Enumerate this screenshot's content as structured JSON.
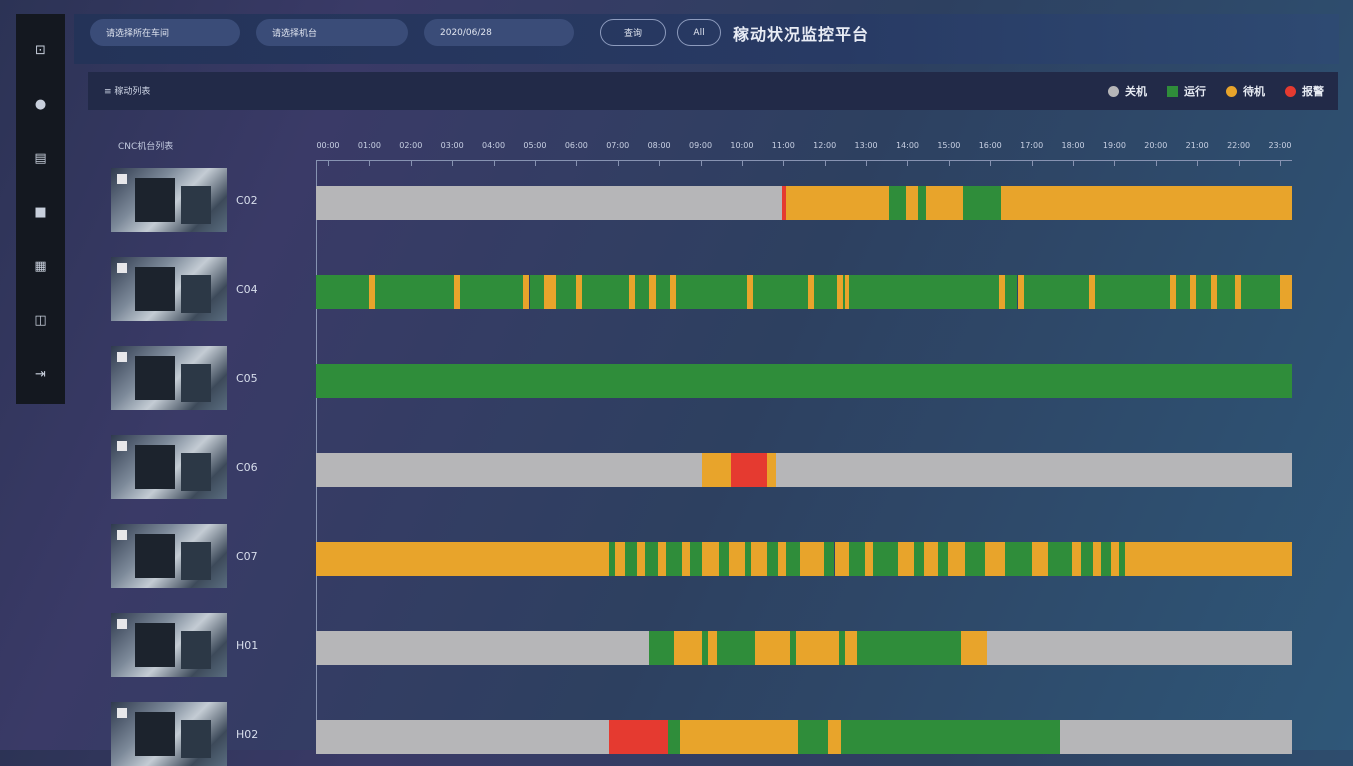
{
  "sidebar": {
    "items": [
      {
        "icon": "monitor-icon",
        "glyph": "⊡"
      },
      {
        "icon": "dashboard-icon",
        "glyph": "●"
      },
      {
        "icon": "chart-icon",
        "glyph": "▤"
      },
      {
        "icon": "document-icon",
        "glyph": "■"
      },
      {
        "icon": "grid-icon",
        "glyph": "▦"
      },
      {
        "icon": "calendar-icon",
        "glyph": "◫"
      },
      {
        "icon": "expand-icon",
        "glyph": "⇥"
      }
    ]
  },
  "topbar": {
    "workshop_select": "请选择所在车间",
    "machine_select": "请选择机台",
    "date_input": "2020/06/28",
    "query_button": "查询",
    "all_button": "All",
    "page_title": "稼动状况监控平台"
  },
  "panel": {
    "title": "≡ 稼动列表",
    "list_label": "CNC机台列表",
    "legend": [
      {
        "label": "关机",
        "color": "#b6b6b8",
        "shape": "dot"
      },
      {
        "label": "运行",
        "color": "#2f8d3a",
        "shape": "square"
      },
      {
        "label": "待机",
        "color": "#e8a42b",
        "shape": "dot"
      },
      {
        "label": "报警",
        "color": "#e53a30",
        "shape": "dot"
      }
    ]
  },
  "timeline": {
    "hours": [
      "00:00",
      "01:00",
      "02:00",
      "03:00",
      "04:00",
      "05:00",
      "06:00",
      "07:00",
      "08:00",
      "09:00",
      "10:00",
      "11:00",
      "12:00",
      "13:00",
      "14:00",
      "15:00",
      "16:00",
      "17:00",
      "18:00",
      "19:00",
      "20:00",
      "21:00",
      "22:00",
      "23:00"
    ]
  },
  "colors": {
    "off": "#b6b6b8",
    "run": "#2f8d3a",
    "idle": "#e8a42b",
    "alarm": "#e53a30"
  },
  "machines": [
    {
      "id": "C02",
      "segments": [
        [
          "off",
          0,
          11.45
        ],
        [
          "alarm",
          11.45,
          11.55
        ],
        [
          "idle",
          11.55,
          14.1
        ],
        [
          "run",
          14.1,
          14.5
        ],
        [
          "idle",
          14.5,
          14.8
        ],
        [
          "run",
          14.8,
          15.0
        ],
        [
          "idle",
          15.0,
          15.9
        ],
        [
          "run",
          15.9,
          16.85
        ],
        [
          "idle",
          16.85,
          24
        ]
      ]
    },
    {
      "id": "C04",
      "segments": [
        [
          "run",
          0,
          1.3
        ],
        [
          "idle",
          1.3,
          1.45
        ],
        [
          "run",
          1.45,
          3.4
        ],
        [
          "idle",
          3.4,
          3.55
        ],
        [
          "run",
          3.55,
          5.1
        ],
        [
          "idle",
          5.1,
          5.25
        ],
        [
          "run",
          5.25,
          5.6
        ],
        [
          "idle",
          5.6,
          5.9
        ],
        [
          "run",
          5.9,
          6.4
        ],
        [
          "idle",
          6.4,
          6.55
        ],
        [
          "run",
          6.55,
          7.7
        ],
        [
          "idle",
          7.7,
          7.85
        ],
        [
          "run",
          7.85,
          8.2
        ],
        [
          "idle",
          8.2,
          8.35
        ],
        [
          "run",
          8.35,
          8.7
        ],
        [
          "idle",
          8.7,
          8.85
        ],
        [
          "run",
          8.85,
          10.6
        ],
        [
          "idle",
          10.6,
          10.75
        ],
        [
          "run",
          10.75,
          12.1
        ],
        [
          "idle",
          12.1,
          12.25
        ],
        [
          "run",
          12.25,
          12.8
        ],
        [
          "idle",
          12.8,
          12.95
        ],
        [
          "run",
          12.95,
          13.0
        ],
        [
          "idle",
          13.0,
          13.1
        ],
        [
          "run",
          13.1,
          16.8
        ],
        [
          "idle",
          16.8,
          16.95
        ],
        [
          "run",
          16.95,
          17.25
        ],
        [
          "idle",
          17.25,
          17.4
        ],
        [
          "run",
          17.4,
          19.0
        ],
        [
          "idle",
          19.0,
          19.15
        ],
        [
          "run",
          19.15,
          21.0
        ],
        [
          "idle",
          21.0,
          21.15
        ],
        [
          "run",
          21.15,
          21.5
        ],
        [
          "idle",
          21.5,
          21.65
        ],
        [
          "run",
          21.65,
          22.0
        ],
        [
          "idle",
          22.0,
          22.15
        ],
        [
          "run",
          22.15,
          22.6
        ],
        [
          "idle",
          22.6,
          22.75
        ],
        [
          "run",
          22.75,
          23.7
        ],
        [
          "idle",
          23.7,
          24
        ]
      ]
    },
    {
      "id": "C05",
      "segments": [
        [
          "run",
          0,
          24
        ]
      ]
    },
    {
      "id": "C06",
      "segments": [
        [
          "off",
          0,
          9.5
        ],
        [
          "idle",
          9.5,
          10.2
        ],
        [
          "alarm",
          10.2,
          11.1
        ],
        [
          "idle",
          11.1,
          11.3
        ],
        [
          "off",
          11.3,
          24
        ]
      ]
    },
    {
      "id": "C07",
      "segments": [
        [
          "idle",
          0,
          7.2
        ],
        [
          "run",
          7.2,
          7.35
        ],
        [
          "idle",
          7.35,
          7.6
        ],
        [
          "run",
          7.6,
          7.9
        ],
        [
          "idle",
          7.9,
          8.1
        ],
        [
          "run",
          8.1,
          8.4
        ],
        [
          "idle",
          8.4,
          8.6
        ],
        [
          "run",
          8.6,
          9.0
        ],
        [
          "idle",
          9.0,
          9.2
        ],
        [
          "run",
          9.2,
          9.5
        ],
        [
          "idle",
          9.5,
          9.9
        ],
        [
          "run",
          9.9,
          10.15
        ],
        [
          "idle",
          10.15,
          10.55
        ],
        [
          "run",
          10.55,
          10.7
        ],
        [
          "idle",
          10.7,
          11.1
        ],
        [
          "run",
          11.1,
          11.35
        ],
        [
          "idle",
          11.35,
          11.55
        ],
        [
          "run",
          11.55,
          11.9
        ],
        [
          "idle",
          11.9,
          12.5
        ],
        [
          "run",
          12.5,
          12.75
        ],
        [
          "idle",
          12.75,
          13.1
        ],
        [
          "run",
          13.1,
          13.5
        ],
        [
          "idle",
          13.5,
          13.7
        ],
        [
          "run",
          13.7,
          14.3
        ],
        [
          "idle",
          14.3,
          14.7
        ],
        [
          "run",
          14.7,
          14.95
        ],
        [
          "idle",
          14.95,
          15.3
        ],
        [
          "run",
          15.3,
          15.55
        ],
        [
          "idle",
          15.55,
          15.95
        ],
        [
          "run",
          15.95,
          16.45
        ],
        [
          "idle",
          16.45,
          16.95
        ],
        [
          "run",
          16.95,
          17.6
        ],
        [
          "idle",
          17.6,
          18.0
        ],
        [
          "run",
          18.0,
          18.6
        ],
        [
          "idle",
          18.6,
          18.8
        ],
        [
          "run",
          18.8,
          19.1
        ],
        [
          "idle",
          19.1,
          19.3
        ],
        [
          "run",
          19.3,
          19.55
        ],
        [
          "idle",
          19.55,
          19.75
        ],
        [
          "run",
          19.75,
          19.9
        ],
        [
          "idle",
          19.9,
          24
        ]
      ]
    },
    {
      "id": "H01",
      "segments": [
        [
          "off",
          0,
          8.2
        ],
        [
          "run",
          8.2,
          8.8
        ],
        [
          "idle",
          8.8,
          9.5
        ],
        [
          "run",
          9.5,
          9.65
        ],
        [
          "idle",
          9.65,
          9.85
        ],
        [
          "run",
          9.85,
          10.8
        ],
        [
          "idle",
          10.8,
          11.65
        ],
        [
          "run",
          11.65,
          11.8
        ],
        [
          "idle",
          11.8,
          12.85
        ],
        [
          "run",
          12.85,
          13.0
        ],
        [
          "idle",
          13.0,
          13.3
        ],
        [
          "run",
          13.3,
          15.85
        ],
        [
          "idle",
          15.85,
          16.5
        ],
        [
          "off",
          16.5,
          24
        ]
      ]
    },
    {
      "id": "H02",
      "segments": [
        [
          "off",
          0,
          7.2
        ],
        [
          "alarm",
          7.2,
          8.65
        ],
        [
          "run",
          8.65,
          8.95
        ],
        [
          "idle",
          8.95,
          11.85
        ],
        [
          "run",
          11.85,
          12.6
        ],
        [
          "idle",
          12.6,
          12.9
        ],
        [
          "run",
          12.9,
          18.3
        ],
        [
          "off",
          18.3,
          24
        ]
      ]
    }
  ]
}
